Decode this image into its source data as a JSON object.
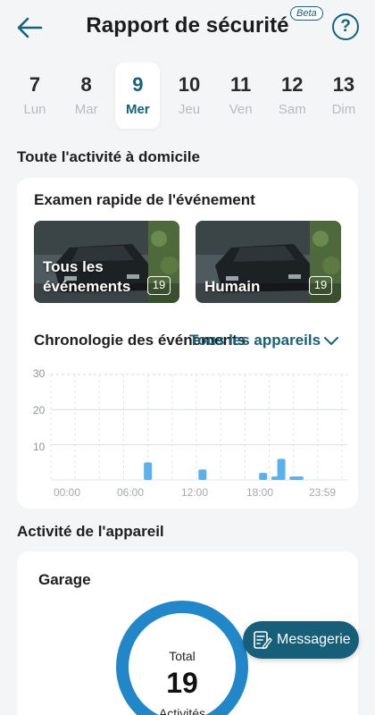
{
  "header": {
    "title": "Rapport de sécurité",
    "beta": "Beta",
    "help": "?"
  },
  "days": [
    {
      "num": "7",
      "label": "Lun"
    },
    {
      "num": "8",
      "label": "Mar"
    },
    {
      "num": "9",
      "label": "Mer",
      "selected": true
    },
    {
      "num": "10",
      "label": "Jeu"
    },
    {
      "num": "11",
      "label": "Ven"
    },
    {
      "num": "12",
      "label": "Sam"
    },
    {
      "num": "13",
      "label": "Dim"
    }
  ],
  "home_activity": {
    "section_title": "Toute l'activité à domicile",
    "quick_review_title": "Examen rapide de l'événement",
    "thumbnails": [
      {
        "label": "Tous les événements",
        "count": "19"
      },
      {
        "label": "Humain",
        "count": "19"
      }
    ],
    "timeline_title": "Chronologie des événements",
    "device_filter": "Tous les appareils"
  },
  "chart_data": {
    "type": "bar",
    "title": "Chronologie des événements",
    "xlabel": "",
    "ylabel": "",
    "ylim": [
      0,
      30
    ],
    "yticks": [
      "30",
      "20",
      "10"
    ],
    "xticks": [
      "00:00",
      "06:00",
      "12:00",
      "18:00",
      "23:59"
    ],
    "x": [
      8,
      12.5,
      17.5,
      18.5,
      19,
      20,
      20.5
    ],
    "values": [
      5,
      3,
      2,
      1,
      6,
      1,
      1
    ],
    "x_unit": "heure",
    "color": "#5ab1ec",
    "grid": true
  },
  "device_activity": {
    "section_title": "Activité de l'appareil",
    "device_name": "Garage",
    "total_label": "Total",
    "total_value": "19",
    "unit_label": "Activités"
  },
  "messaging_label": "Messagerie",
  "colors": {
    "accent": "#17627a",
    "bar": "#5ab1ec",
    "donut": "#2287c9",
    "fab": "#175e78"
  }
}
